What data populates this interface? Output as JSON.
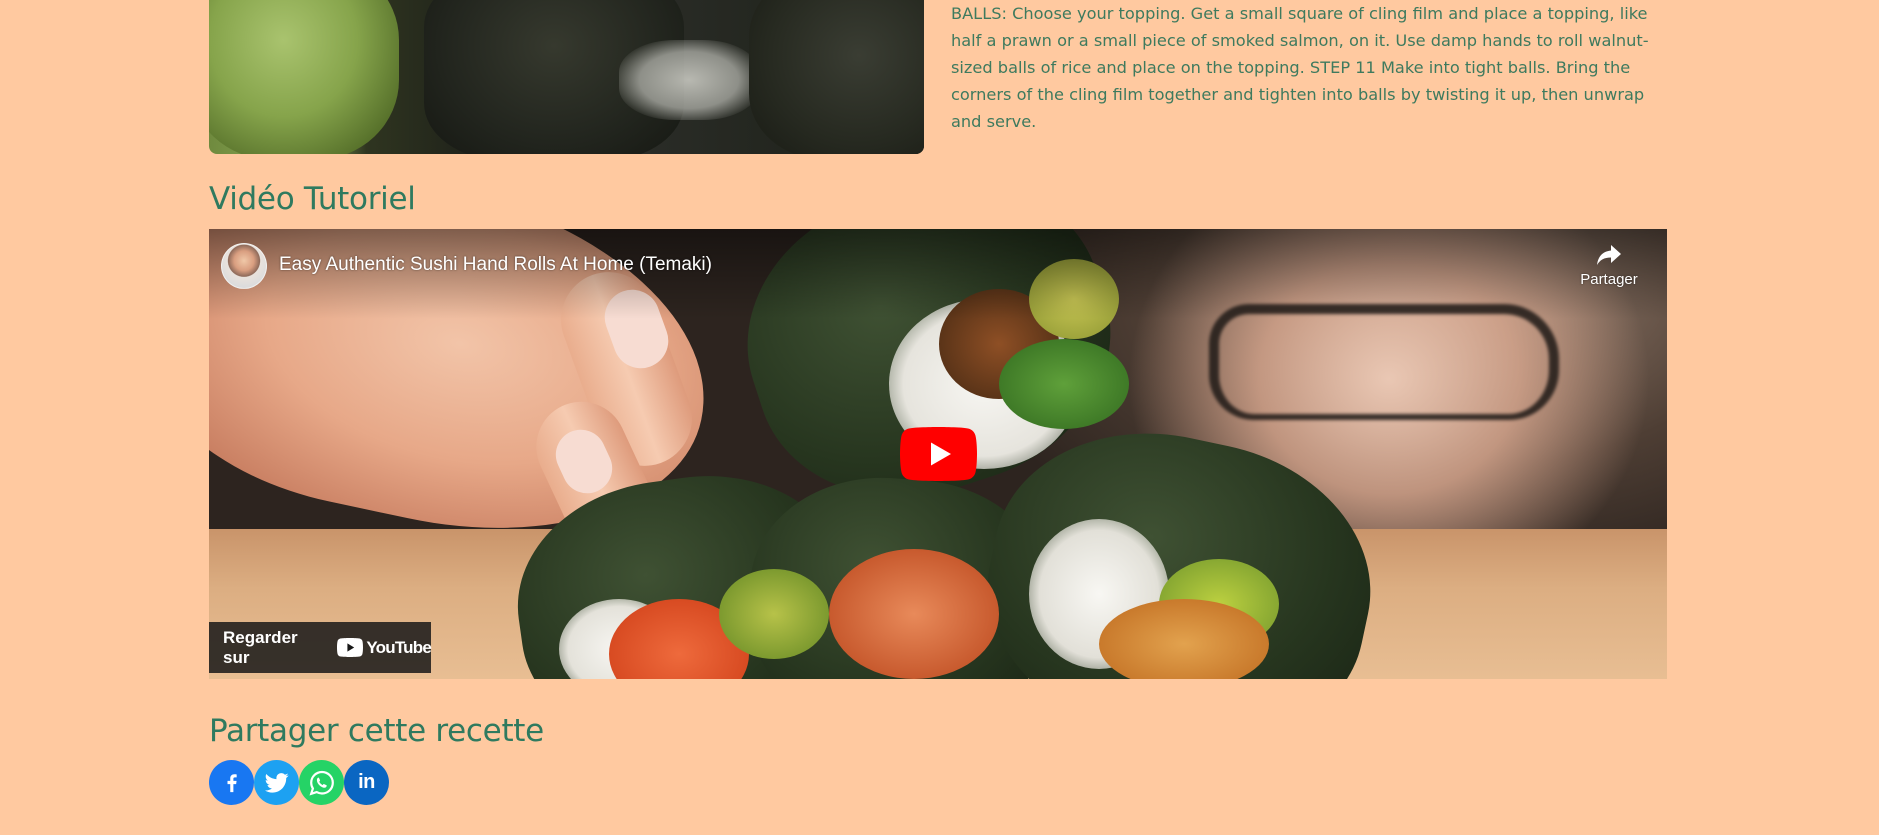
{
  "recipe": {
    "step_text": "BALLS: Choose your topping. Get a small square of cling film and place a topping, like half a prawn or a small piece of smoked salmon, on it. Use damp hands to roll walnut-sized balls of rice and place on the topping. STEP 11 Make into tight balls. Bring the corners of the cling film together and tighten into balls by twisting it up, then unwrap and serve."
  },
  "video_section": {
    "heading": "Vidéo Tutoriel",
    "video_title": "Easy Authentic Sushi Hand Rolls At Home (Temaki)",
    "share_label": "Partager",
    "watch_on_label": "Regarder sur",
    "youtube_wordmark": "YouTube",
    "play_icon": "youtube-play-icon",
    "brand_red": "#ff0000"
  },
  "share_section": {
    "heading": "Partager cette recette",
    "buttons": [
      {
        "network": "facebook",
        "icon": "facebook-icon",
        "color": "#1877f2"
      },
      {
        "network": "twitter",
        "icon": "twitter-icon",
        "color": "#1da1f2"
      },
      {
        "network": "whatsapp",
        "icon": "whatsapp-icon",
        "color": "#25d366"
      },
      {
        "network": "linkedin",
        "icon": "linkedin-icon",
        "label": "in",
        "color": "#0a66c2"
      }
    ]
  },
  "theme": {
    "background": "#ffc9a0",
    "heading_color": "#2f7a5f",
    "text_color": "#3e7a5e"
  }
}
